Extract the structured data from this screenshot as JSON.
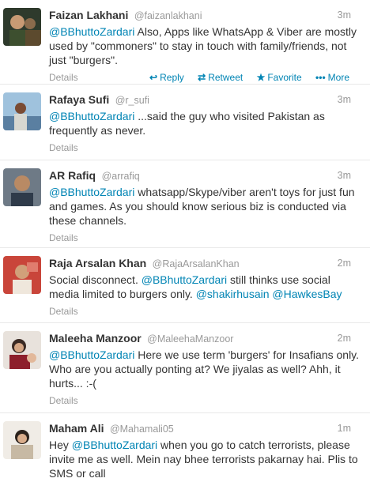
{
  "tweets": [
    {
      "name": "Faizan Lakhani",
      "handle": "@faizanlakhani",
      "time": "3m",
      "parts": [
        "@BBhuttoZardari",
        " Also, Apps like WhatsApp & Viber are mostly used by \"commoners\" to stay in touch with family/friends, not just \"burgers\"."
      ],
      "details": "Details",
      "actions": {
        "reply": "Reply",
        "retweet": "Retweet",
        "favorite": "Favorite",
        "more": "More"
      }
    },
    {
      "name": "Rafaya Sufi",
      "handle": "@r_sufi",
      "time": "3m",
      "parts": [
        "@BBhuttoZardari",
        " ...said the guy who visited Pakistan as frequently as never."
      ],
      "details": "Details"
    },
    {
      "name": "AR Rafiq",
      "handle": "@arrafiq",
      "time": "3m",
      "parts": [
        "@BBhuttoZardari",
        "  whatsapp/Skype/viber aren't toys for just fun and games. As you should know serious biz is conducted via these channels."
      ],
      "details": "Details"
    },
    {
      "name": "Raja Arsalan Khan",
      "handle": "@RajaArsalanKhan",
      "time": "2m",
      "parts": [
        "Social disconnect. ",
        "@BBhuttoZardari",
        " still thinks use social media limited to burgers only. ",
        "@shakirhusain",
        "  ",
        "@HawkesBay"
      ],
      "details": "Details"
    },
    {
      "name": "Maleeha Manzoor",
      "handle": "@MaleehaManzoor",
      "time": "2m",
      "parts": [
        "@BBhuttoZardari",
        " Here we use term 'burgers' for Insafians only. Who are you actually ponting at? We jiyalas as well? Ahh, it hurts... :-("
      ],
      "details": "Details"
    },
    {
      "name": "Maham Ali",
      "handle": "@Mahamali05",
      "time": "1m",
      "parts": [
        "Hey ",
        "@BBhuttoZardari",
        " when you go to catch terrorists, please invite me as well. Mein nay bhee terrorists pakarnay hai. Plis to SMS or call"
      ],
      "details": ""
    }
  ],
  "colors": {
    "link": "#0084b4",
    "muted": "#999999",
    "text": "#333333",
    "divider": "#e8e8e8"
  },
  "icons": {
    "reply": "reply-arrow-icon",
    "retweet": "retweet-icon",
    "favorite": "star-icon",
    "more": "dots-icon"
  }
}
